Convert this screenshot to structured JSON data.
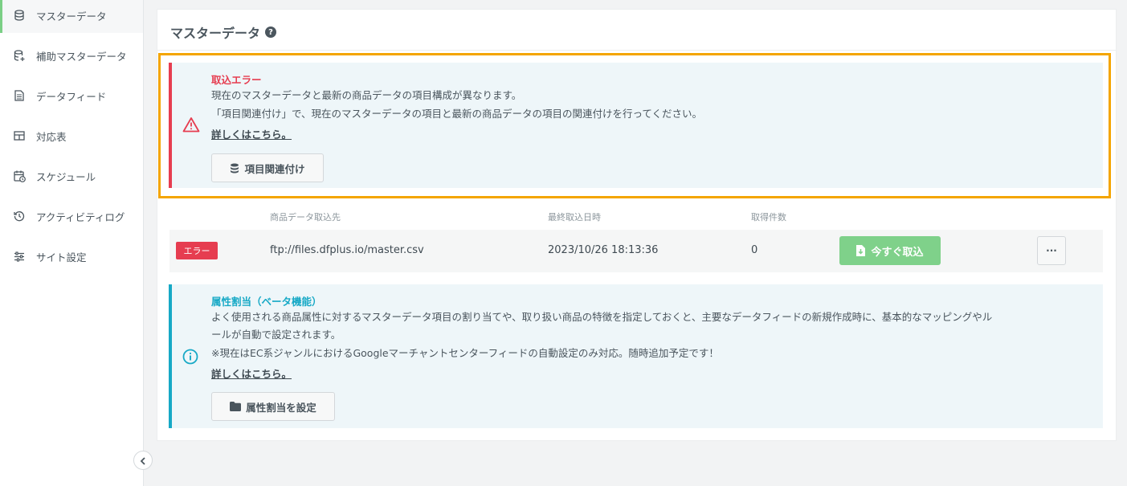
{
  "sidebar": {
    "items": [
      {
        "label": "マスターデータ",
        "icon": "database-icon"
      },
      {
        "label": "補助マスターデータ",
        "icon": "database-plus-icon"
      },
      {
        "label": "データフィード",
        "icon": "document-icon"
      },
      {
        "label": "対応表",
        "icon": "table-icon"
      },
      {
        "label": "スケジュール",
        "icon": "calendar-clock-icon"
      },
      {
        "label": "アクティビティログ",
        "icon": "history-icon"
      },
      {
        "label": "サイト設定",
        "icon": "sliders-icon"
      }
    ]
  },
  "page": {
    "title": "マスターデータ"
  },
  "error_alert": {
    "title": "取込エラー",
    "line1": "現在のマスターデータと最新の商品データの項目構成が異なります。",
    "line2": "「項目関連付け」で、現在のマスターデータの項目と最新の商品データの項目の関連付けを行ってください。",
    "link": "詳しくはこちら。",
    "button": "項目関連付け"
  },
  "table": {
    "headers": [
      "商品データ取込先",
      "最終取込日時",
      "取得件数"
    ],
    "row": {
      "status": "エラー",
      "source": "ftp://files.dfplus.io/master.csv",
      "last_import": "2023/10/26 18:13:36",
      "count": "0",
      "import_button": "今すぐ取込",
      "more": "···"
    }
  },
  "info_alert": {
    "title": "属性割当（ベータ機能）",
    "line1": "よく使用される商品属性に対するマスターデータ項目の割り当てや、取り扱い商品の特徴を指定しておくと、主要なデータフィードの新規作成時に、基本的なマッピングやル",
    "line2": "ールが自動で設定されます。",
    "line3": "※現在はEC系ジャンルにおけるGoogleマーチャントセンターフィードの自動設定のみ対応。随時追加予定です！",
    "link": "詳しくはこちら。",
    "button": "属性割当を設定"
  },
  "colors": {
    "error": "#e63d50",
    "info": "#17a9c6",
    "success": "#7fd18a",
    "highlight": "#f4a500"
  }
}
